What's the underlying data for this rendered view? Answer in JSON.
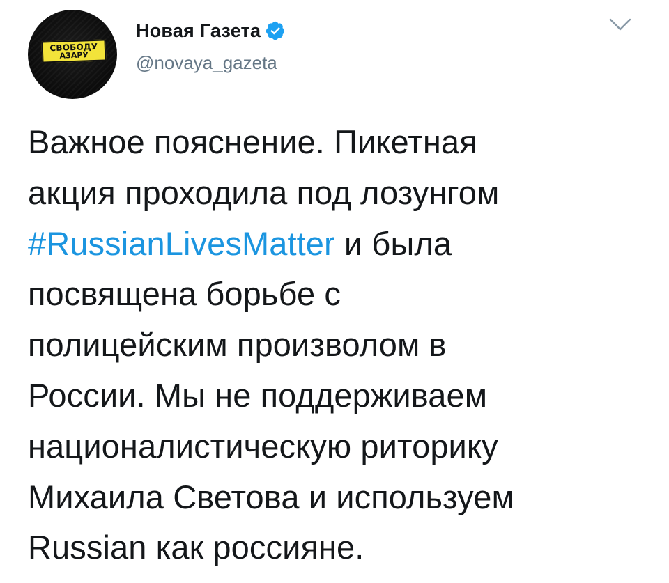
{
  "account": {
    "avatar_stamp_line1": "СВОБОДУ",
    "avatar_stamp_line2": "АЗАРУ",
    "display_name": "Новая Газета",
    "handle": "@novaya_gazeta",
    "verified": true
  },
  "tweet": {
    "lines": [
      {
        "text": "Важное пояснение. Пикетная"
      },
      {
        "text": "акция проходила под лозунгом"
      },
      {
        "hashtag": "#RussianLivesMatter",
        "text": " и была"
      },
      {
        "text": "посвящена борьбе с"
      },
      {
        "text": "полицейским произволом в"
      },
      {
        "text": "России. Мы не поддерживаем"
      },
      {
        "text": "националистическую риторику"
      },
      {
        "text": "Михаила Светова и используем"
      },
      {
        "text": "Russian как россияне."
      }
    ]
  },
  "icons": {
    "verified": "verified-badge-icon",
    "caret": "chevron-down-icon"
  },
  "colors": {
    "text": "#14171a",
    "secondary": "#657786",
    "link": "#1b95e0",
    "verified": "#1da1f2"
  }
}
